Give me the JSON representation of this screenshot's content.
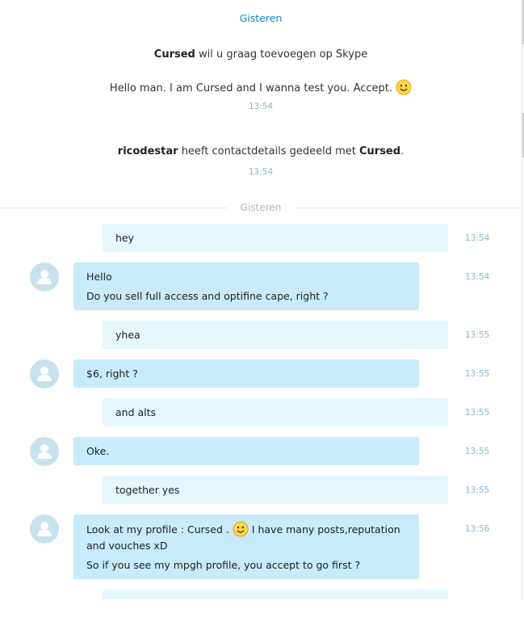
{
  "header": {
    "day_label": "Gisteren"
  },
  "system_events": {
    "request_name": "Cursed",
    "request_text": " wil u graag toevoegen op Skype",
    "request_message": "Hello man. I am Cursed and I wanna test you. Accept.",
    "request_time": "13:54",
    "share_user": "ricodestar",
    "share_text": " heeft contactdetails gedeeld met ",
    "share_target": "Cursed",
    "share_end": ".",
    "share_time": "13:54"
  },
  "divider": {
    "label": "Gisteren"
  },
  "messages": [
    {
      "from": "me",
      "lines": [
        "hey"
      ],
      "time": "13:54"
    },
    {
      "from": "them",
      "lines": [
        "Hello",
        "Do you sell full access and optifine cape, right ?"
      ],
      "time": "13:54"
    },
    {
      "from": "me",
      "lines": [
        "yhea"
      ],
      "time": "13:55"
    },
    {
      "from": "them",
      "lines": [
        "$6, right ?"
      ],
      "time": "13:55"
    },
    {
      "from": "me",
      "lines": [
        "and alts"
      ],
      "time": "13:55"
    },
    {
      "from": "them",
      "lines": [
        "Oke."
      ],
      "time": "13:55"
    },
    {
      "from": "me",
      "lines": [
        "together yes"
      ],
      "time": "13:55"
    },
    {
      "from": "them",
      "lines": [
        "Look at my profile : Cursed .",
        " I have many posts,reputation",
        "and vouches xD",
        "So if you see my mpgh profile, you accept to go first ?"
      ],
      "time": "13:56"
    }
  ],
  "colors": {
    "accent": "#0e8bd6",
    "my_bubble": "#e5f6fd",
    "their_bubble": "#c7ebfa",
    "timestamp": "#8bb6cf"
  },
  "icons": {
    "avatar": "default-user-avatar-icon",
    "emoticon": "smile-emoticon-icon"
  }
}
